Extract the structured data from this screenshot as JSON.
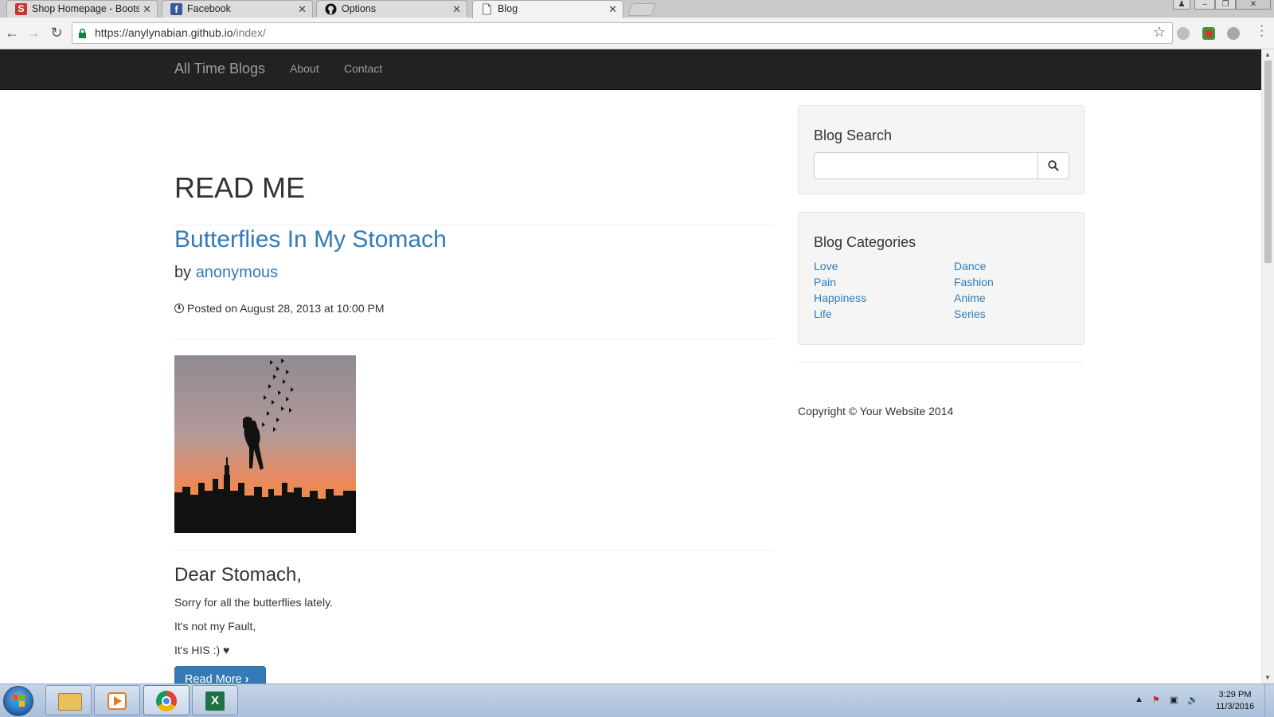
{
  "browser": {
    "tabs": [
      {
        "title": "Shop Homepage - Boots",
        "icon": "letter-s-icon"
      },
      {
        "title": "Facebook",
        "icon": "facebook-icon"
      },
      {
        "title": "Options",
        "icon": "github-icon"
      },
      {
        "title": "Blog",
        "icon": "page-icon"
      }
    ],
    "url_host": "https://anylynabian.github.io",
    "url_path": "/index/"
  },
  "navbar": {
    "brand": "All Time Blogs",
    "links": [
      "About",
      "Contact"
    ]
  },
  "main": {
    "heading": "READ ME",
    "post_title": "Butterflies In My Stomach",
    "by_prefix": "by",
    "author": "anonymous",
    "posted": "Posted on August 28, 2013 at 10:00 PM",
    "greeting": "Dear Stomach,",
    "paragraphs": [
      "Sorry for all the butterflies lately.",
      "It's not my Fault,",
      "It's HIS :)"
    ],
    "read_more": "Read More"
  },
  "sidebar": {
    "search_title": "Blog Search",
    "categories_title": "Blog Categories",
    "categories_left": [
      "Love",
      "Pain",
      "Happiness",
      "Life"
    ],
    "categories_right": [
      "Dance",
      "Fashion",
      "Anime",
      "Series"
    ]
  },
  "footer": {
    "copyright": "Copyright © Your Website 2014"
  },
  "taskbar": {
    "time": "3:29 PM",
    "date": "11/3/2016"
  },
  "colors": {
    "link": "#337ab7",
    "navbar": "#222222",
    "button": "#337ab7"
  }
}
